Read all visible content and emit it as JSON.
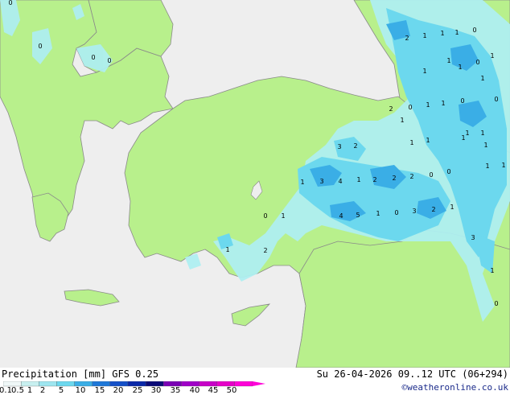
{
  "footer": {
    "title_left": "Precipitation [mm]  GFS 0.25",
    "title_right": "Su 26-04-2026 09..12 UTC (06+294)",
    "credit": "©weatheronline.co.uk"
  },
  "colors": {
    "sea": "#eeeeee",
    "land": "#b8f08c",
    "border": "#8a8a8a",
    "precip_light": "#aeeef0",
    "precip_mid": "#6cd8ee",
    "precip_strong": "#3aaee6"
  },
  "scale": {
    "labels": [
      "0.1",
      "0.5",
      "1",
      "2",
      "5",
      "10",
      "15",
      "20",
      "25",
      "30",
      "35",
      "40",
      "45",
      "50"
    ],
    "colors": [
      "#f0f8f8",
      "#c8f0f0",
      "#9ee6f0",
      "#6cd8ee",
      "#3aaee6",
      "#1e78d8",
      "#1450c8",
      "#0a28a8",
      "#0a0a78",
      "#7a00b4",
      "#a000c8",
      "#c800c8",
      "#e600c8",
      "#ff00d8"
    ]
  },
  "map_values": [
    {
      "label": "0"
    },
    {
      "label": "0"
    },
    {
      "label": "0"
    },
    {
      "label": "0"
    },
    {
      "label": "2"
    },
    {
      "label": "1"
    },
    {
      "label": "1"
    },
    {
      "label": "1"
    },
    {
      "label": "0"
    },
    {
      "label": "1"
    },
    {
      "label": "1"
    },
    {
      "label": "0"
    },
    {
      "label": "1"
    },
    {
      "label": "1"
    },
    {
      "label": "1"
    },
    {
      "label": "0"
    },
    {
      "label": "2"
    },
    {
      "label": "0"
    },
    {
      "label": "1"
    },
    {
      "label": "1"
    },
    {
      "label": "0"
    },
    {
      "label": "1"
    },
    {
      "label": "1"
    },
    {
      "label": "1"
    },
    {
      "label": "3"
    },
    {
      "label": "2"
    },
    {
      "label": "1"
    },
    {
      "label": "1"
    },
    {
      "label": "1"
    },
    {
      "label": "1"
    },
    {
      "label": "1"
    },
    {
      "label": "3"
    },
    {
      "label": "4"
    },
    {
      "label": "1"
    },
    {
      "label": "2"
    },
    {
      "label": "2"
    },
    {
      "label": "2"
    },
    {
      "label": "0"
    },
    {
      "label": "0"
    },
    {
      "label": "1"
    },
    {
      "label": "1"
    },
    {
      "label": "0"
    },
    {
      "label": "1"
    },
    {
      "label": "4"
    },
    {
      "label": "5"
    },
    {
      "label": "1"
    },
    {
      "label": "0"
    },
    {
      "label": "3"
    },
    {
      "label": "2"
    },
    {
      "label": "1"
    },
    {
      "label": "1"
    },
    {
      "label": "2"
    },
    {
      "label": "3"
    },
    {
      "label": "1"
    },
    {
      "label": "0"
    }
  ]
}
